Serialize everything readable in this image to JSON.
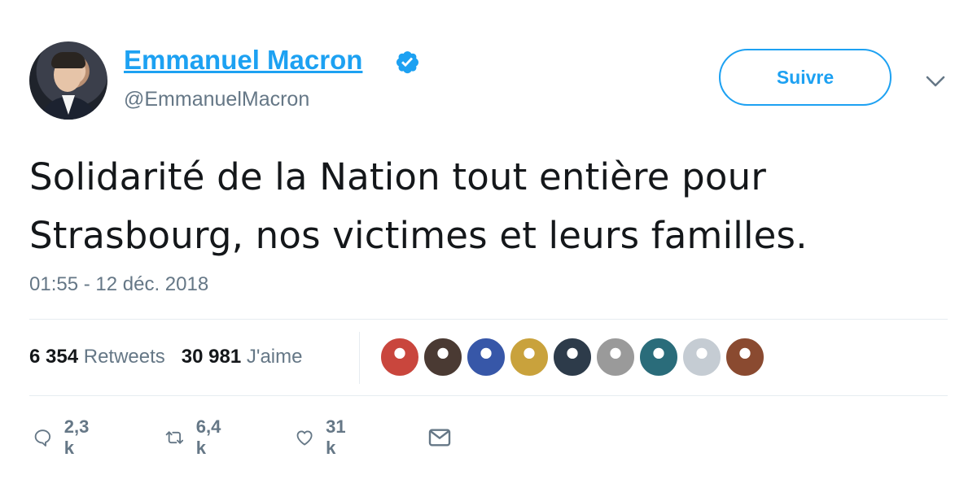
{
  "author": {
    "name": "Emmanuel Macron",
    "handle": "@EmmanuelMacron",
    "verified": true,
    "avatar_icon": "profile-photo"
  },
  "follow_button": {
    "label": "Suivre"
  },
  "tweet": {
    "text_line1": "Solidarité de la Nation tout entière pour",
    "text_line2": "Strasbourg, nos victimes et leurs familles.",
    "timestamp": "01:55 - 12 déc. 2018"
  },
  "stats": {
    "retweets_count": "6 354",
    "retweets_label": "Retweets",
    "likes_count": "30 981",
    "likes_label": "J'aime"
  },
  "likers": [
    {
      "icon": "avatar-1",
      "color": "#c9463d"
    },
    {
      "icon": "avatar-2",
      "color": "#4a3a33"
    },
    {
      "icon": "avatar-3",
      "color": "#3757a8"
    },
    {
      "icon": "avatar-4",
      "color": "#c9a23c"
    },
    {
      "icon": "avatar-5",
      "color": "#2d3b4a"
    },
    {
      "icon": "avatar-6",
      "color": "#9a9a9a"
    },
    {
      "icon": "avatar-7",
      "color": "#2a6c7a"
    },
    {
      "icon": "avatar-8",
      "color": "#c5ccd3"
    },
    {
      "icon": "avatar-9",
      "color": "#8a4a30"
    }
  ],
  "actions": {
    "reply_count": "2,3 k",
    "retweet_count": "6,4 k",
    "like_count": "31 k"
  },
  "colors": {
    "accent": "#1da1f2",
    "text": "#14171a",
    "secondary": "#657786",
    "divider": "#e6ecf0"
  }
}
